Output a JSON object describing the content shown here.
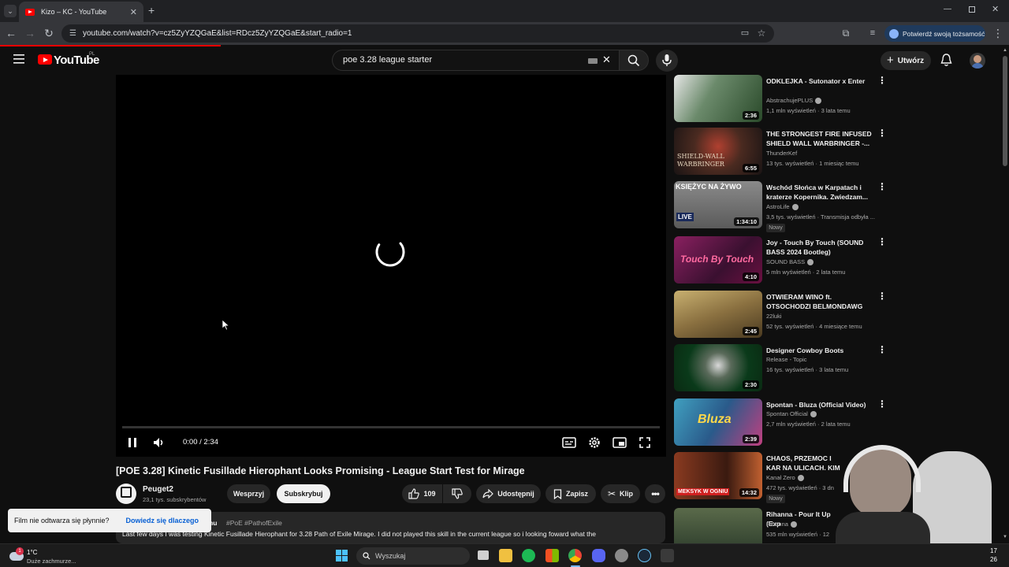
{
  "browser": {
    "tab_title": "Kizo – KC - YouTube",
    "url": "youtube.com/watch?v=cz5ZyYZQGaE&list=RDcz5ZyYZQGaE&start_radio=1",
    "verify_label": "Potwierdź swoją tożsamość"
  },
  "youtube": {
    "logo_text": "YouTube",
    "country_code": "PL",
    "search_value": "poe 3.28 league starter",
    "create_label": "Utwórz"
  },
  "player": {
    "time_display": "0:00 / 2:34",
    "progress": 0
  },
  "video": {
    "title": "[POE 3.28] Kinetic Fusillade Hierophant Looks Promising - League Start Test for Mirage",
    "channel": "Peuget2",
    "subscribers": "23,1 tys. subskrybentów",
    "support_label": "Wesprzyj",
    "subscribe_label": "Subskrybuj",
    "likes": "109",
    "share_label": "Udostępnij",
    "save_label": "Zapisz",
    "clip_label": "Klip",
    "desc_partial": "emu",
    "hashtags": "#PoE #PathofExile",
    "description": "Last few days I was testing Kinetic Fusillade Hierophant for 3.28 Path of Exile Mirage.  I did not played this skill in the current league so i looking foward what the"
  },
  "toast": {
    "message": "Film nie odtwarza się płynnie?",
    "link": "Dowiedz się dlaczego"
  },
  "recommendations": [
    {
      "title": "ODKLEJKA - Sutonator x Enter",
      "channel": "AbstrachujePLUS",
      "verified": true,
      "meta": "1,1 mln wyświetleń · 3 lata temu",
      "duration": "2:36",
      "is_new": false,
      "thumb_color": "#3a5a3a"
    },
    {
      "title": "THE STRONGEST FIRE INFUSED SHIELD WALL WARBRINGER  -...",
      "channel": "ThunderKef",
      "verified": false,
      "meta": "13 tys. wyświetleń · 1 miesiąc temu",
      "duration": "6:55",
      "is_new": false,
      "thumb_color": "#4a2a20",
      "thumb_text": "SHIELD-WALL WARBRINGER"
    },
    {
      "title": "Wschód Słońca w Karpatach i kraterze Kopernika. Zwiedzam...",
      "channel": "AstroLife",
      "verified": true,
      "meta": "3,5 tys. wyświetleń · Transmisja odbyła ...",
      "duration": "1:34:10",
      "is_new": true,
      "thumb_color": "#6a6a6a",
      "thumb_text": "KSIĘŻYC NA ŻYWO"
    },
    {
      "title": "Joy - Touch By Touch (SOUND BASS 2024 Bootleg)",
      "channel": "SOUND BASS",
      "verified": true,
      "meta": "5 mln wyświetleń · 2 lata temu",
      "duration": "4:10",
      "is_new": false,
      "thumb_color": "#5a2040",
      "thumb_text": "Touch By Touch"
    },
    {
      "title": "OTWIERAM WINO ft. OTSOCHODZI BELMONDAWG",
      "channel": "22luki",
      "verified": false,
      "meta": "52 tys. wyświetleń · 4 miesiące temu",
      "duration": "2:45",
      "is_new": false,
      "thumb_color": "#8a7a40"
    },
    {
      "title": "Designer Cowboy Boots",
      "channel": "Release - Topic",
      "verified": false,
      "meta": "16 tys. wyświetleń · 3 lata temu",
      "duration": "2:30",
      "is_new": false,
      "thumb_color": "#1a5a2a"
    },
    {
      "title": "Spontan - Bluza (Official Video)",
      "channel": "Spontan Official",
      "verified": true,
      "meta": "2,7 mln wyświetleń · 2 lata temu",
      "duration": "2:39",
      "is_new": false,
      "thumb_color": "#2a6a8a",
      "thumb_text": "Bluza"
    },
    {
      "title": "CHAOS, PRZEMOC I KAR NA ULICACH. KIM BYŁ",
      "channel": "Kanał Zero",
      "verified": true,
      "meta": "472 tys. wyświetleń · 3 dn",
      "duration": "14:32",
      "is_new": true,
      "thumb_color": "#5a2a1a",
      "thumb_text": "MEKSYK W OGNIU"
    },
    {
      "title": "Rihanna - Pour It Up (Exp",
      "channel": "Rihanna",
      "verified": true,
      "meta": "535 mln wyświetleń · 12",
      "duration": "",
      "is_new": false,
      "thumb_color": "#3a4a3a"
    }
  ],
  "taskbar": {
    "weather_temp": "1°C",
    "weather_desc": "Duże zachmurze...",
    "search_placeholder": "Wyszukaj",
    "clock_line1": "17",
    "clock_line2": "26",
    "notification_count": "1"
  }
}
